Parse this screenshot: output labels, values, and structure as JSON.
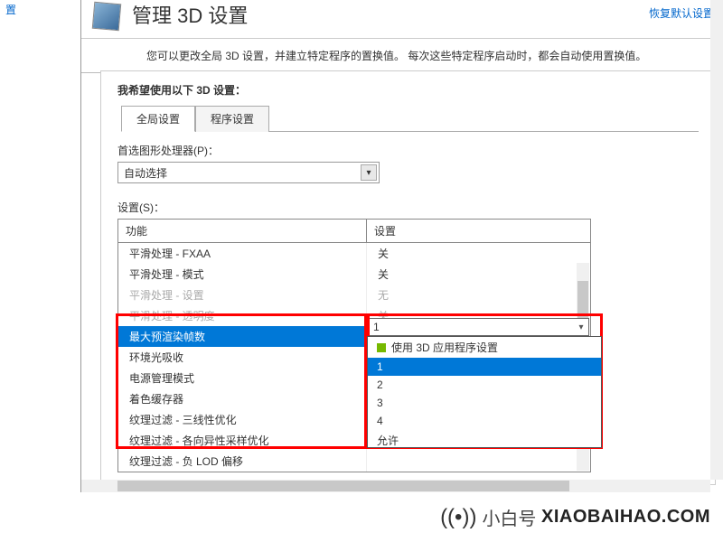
{
  "watermark_text": "@小白号",
  "watermark_url": "XIAOBAIHAO.COM",
  "left_nav": {
    "truncated_item": "置"
  },
  "header": {
    "title": "管理 3D 设置",
    "restore": "恢复默认设置"
  },
  "description": "您可以更改全局 3D 设置，并建立特定程序的置换值。 每次这些特定程序启动时，都会自动使用置换值。",
  "section_label": "我希望使用以下 3D 设置：",
  "tabs": {
    "global": "全局设置",
    "program": "程序设置"
  },
  "gpu_label": "首选图形处理器(P)：",
  "gpu_value": "自动选择",
  "settings_label": "设置(S)：",
  "table": {
    "col_feature": "功能",
    "col_value": "设置",
    "rows": [
      {
        "label": "平滑处理 - FXAA",
        "value": "关",
        "disabled": false
      },
      {
        "label": "平滑处理 - 模式",
        "value": "关",
        "disabled": false
      },
      {
        "label": "平滑处理 - 设置",
        "value": "无",
        "disabled": true
      },
      {
        "label": "平滑处理 - 透明度",
        "value": "关",
        "disabled": true
      },
      {
        "label": "最大预渲染帧数",
        "value": "1",
        "disabled": false,
        "selected": true
      },
      {
        "label": "环境光吸收",
        "value": "",
        "disabled": false
      },
      {
        "label": "电源管理模式",
        "value": "",
        "disabled": false
      },
      {
        "label": "着色缓存器",
        "value": "",
        "disabled": false
      },
      {
        "label": "纹理过滤 - 三线性优化",
        "value": "",
        "disabled": false
      },
      {
        "label": "纹理过滤 - 各向异性采样优化",
        "value": "",
        "disabled": false
      },
      {
        "label": "纹理过滤 - 负 LOD 偏移",
        "value": "",
        "disabled": false
      }
    ]
  },
  "dropdown_open": {
    "selected_display": "1",
    "options": [
      {
        "label": "使用 3D 应用程序设置",
        "nv": true
      },
      {
        "label": "1",
        "selected": true
      },
      {
        "label": "2"
      },
      {
        "label": "3"
      },
      {
        "label": "4"
      },
      {
        "label": "允许"
      }
    ]
  },
  "brand": {
    "name": "小白号",
    "domain": "XIAOBAIHAO.COM"
  }
}
